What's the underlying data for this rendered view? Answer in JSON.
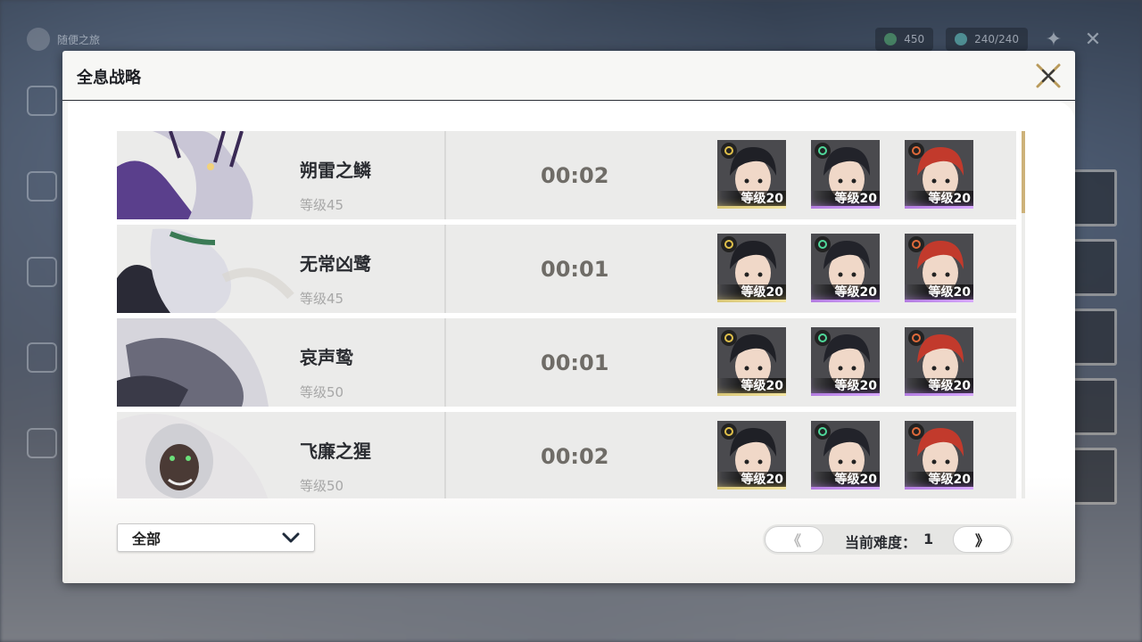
{
  "modal": {
    "title": "全息战略"
  },
  "background_topbar": {
    "home_label": "随便之旅",
    "currency_1": "450",
    "currency_2": "240/240"
  },
  "bosses": [
    {
      "name": "朔雷之鳞",
      "level": "等级45",
      "time": "00:02"
    },
    {
      "name": "无常凶鹭",
      "level": "等级45",
      "time": "00:01"
    },
    {
      "name": "哀声鸷",
      "level": "等级50",
      "time": "00:01"
    },
    {
      "name": "飞廉之猩",
      "level": "等级50",
      "time": "00:02"
    }
  ],
  "team": [
    {
      "level": "等级20",
      "rarity": "gold",
      "element": "electro-icon",
      "element_color": "#e0c04a",
      "hair_color": "#1f2026"
    },
    {
      "level": "等级20",
      "rarity": "purple",
      "element": "aero-icon",
      "element_color": "#4fd89a",
      "hair_color": "#22232a"
    },
    {
      "level": "等级20",
      "rarity": "purple",
      "element": "fusion-icon",
      "element_color": "#e06a3a",
      "hair_color": "#c23a2c"
    }
  ],
  "filter": {
    "selected": "全部"
  },
  "pager": {
    "prev": "《",
    "next": "》",
    "difficulty_label": "当前难度：",
    "difficulty_value": "1"
  },
  "colors": {
    "accent_gold": "#cdb27a",
    "row_bg": "#ebebea",
    "time_color": "#6f6c67"
  }
}
